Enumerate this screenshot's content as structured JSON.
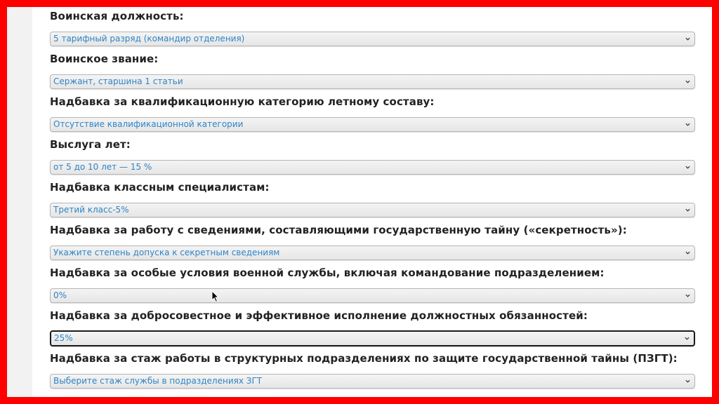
{
  "form": {
    "fields": [
      {
        "label": "Воинская должность:",
        "value": "5 тарифный разряд (командир отделения)"
      },
      {
        "label": "Воинское звание:",
        "value": "Сержант, старшина 1 статьи"
      },
      {
        "label": "Надбавка за квалификационную категорию летному составу:",
        "value": "Отсутствие квалификационной категории"
      },
      {
        "label": "Выслуга лет:",
        "value": "от 5 до 10 лет — 15 %"
      },
      {
        "label": "Надбавка классным специалистам:",
        "value": "Третий класс-5%"
      },
      {
        "label": "Надбавка за работу с сведениями, составляющими государственную тайну («секретность»):",
        "value": "Укажите степень допуска к секретным сведениям"
      },
      {
        "label": "Надбавка за особые условия военной службы, включая командование подразделением:",
        "value": "0%"
      },
      {
        "label": "Надбавка за добросовестное и эффективное исполнение должностных обязанностей:",
        "value": "25%"
      },
      {
        "label": "Надбавка за стаж работы в структурных подразделениях по защите государственной тайны (ПЗГТ):",
        "value": "Выберите стаж службы в подразделениях ЗГТ"
      }
    ]
  },
  "icons": {
    "dropdown": "chevron-down-icon",
    "pointer": "mouse-cursor-icon"
  },
  "colors": {
    "frame_border": "#ff0000",
    "select_text": "#2f84c6",
    "label_text": "#222222"
  }
}
